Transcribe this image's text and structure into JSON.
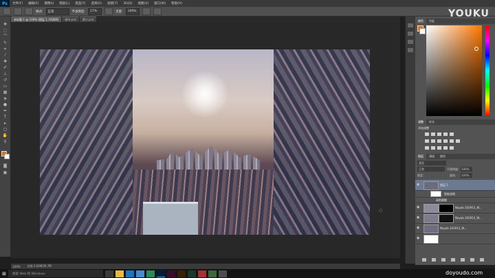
{
  "app": {
    "logo": "Ps",
    "menu": [
      "文件(F)",
      "编辑(E)",
      "图像(I)",
      "图层(L)",
      "类型(Y)",
      "选择(S)",
      "滤镜(T)",
      "3D(D)",
      "视图(V)",
      "窗口(W)",
      "帮助(H)"
    ]
  },
  "options": {
    "mode_label": "模式:",
    "mode_value": "正常",
    "opacity_label": "不透明度:",
    "opacity_value": "17%",
    "flow_label": "流量:",
    "flow_value": "100%"
  },
  "tabs": [
    "未标题-1 @ 100% (图层 1, RGB/8)",
    "城市.psd",
    "港口.psd"
  ],
  "watermark": "YOUKU",
  "watermark2": "doyoudo.com",
  "panels": {
    "color_tabs": [
      "颜色",
      "色板"
    ],
    "adjust_tabs": [
      "调整",
      "样式"
    ],
    "adjust_title": "添加调整",
    "layers_tabs": [
      "图层",
      "通道",
      "路径"
    ],
    "kind_label": "类型",
    "blend_mode": "正常",
    "opacity_label": "不透明度:",
    "opacity_value": "100%",
    "lock_label": "锁定:",
    "fill_label": "填充:",
    "fill_value": "100%",
    "layers": [
      {
        "name": "图层 1",
        "selected": true
      },
      {
        "name": "智能滤镜",
        "selected": false
      },
      {
        "name": "高斯模糊",
        "selected": false
      },
      {
        "name": "Nayab 203912_W...",
        "selected": false
      },
      {
        "name": "Nayab 203912_W...",
        "selected": false
      },
      {
        "name": "Nayab 203912_W...",
        "selected": false
      },
      {
        "name": "",
        "selected": false
      }
    ]
  },
  "status": {
    "zoom": "100%",
    "doc": "文档:3.64M/26.7M"
  },
  "taskbar": {
    "search_placeholder": "搜索 Web 和 Windows"
  }
}
